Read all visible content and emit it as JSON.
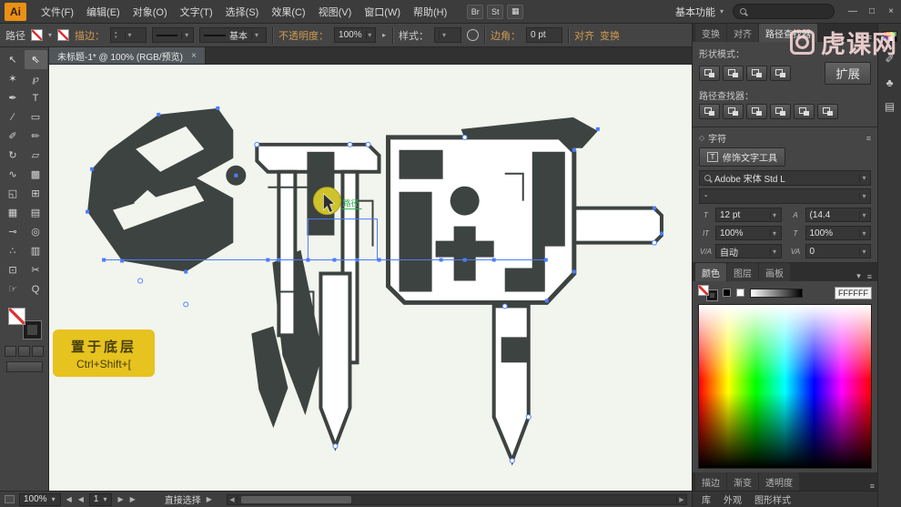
{
  "menubar": {
    "app_label": "Ai",
    "items": [
      "文件(F)",
      "编辑(E)",
      "对象(O)",
      "文字(T)",
      "选择(S)",
      "效果(C)",
      "视图(V)",
      "窗口(W)",
      "帮助(H)"
    ],
    "quick_icons": [
      {
        "name": "bridge-button",
        "glyph": "Br"
      },
      {
        "name": "stock-button",
        "glyph": "St"
      },
      {
        "name": "arrange-documents-button",
        "glyph": "▦"
      }
    ],
    "workspace_label": "基本功能",
    "search_value": "",
    "window_controls": {
      "minimize": "—",
      "restore": "□",
      "close": "×"
    }
  },
  "controlbar": {
    "context_label": "路径",
    "stroke_label": "描边：",
    "stroke_weight_value": "",
    "brush_name": "基本",
    "opacity_label": "不透明度：",
    "opacity_value": "100%",
    "style_label": "样式：",
    "corner_label": "边角：",
    "corner_value": "0 pt",
    "align_label": "对齐",
    "transform_label": "变换"
  },
  "watermark_text": "虎课网",
  "document_tab": {
    "title": "未标题-1* @ 100% (RGB/预览)",
    "close_glyph": "×"
  },
  "toolbar": {
    "tools": [
      {
        "name": "selection-tool",
        "glyph": "↖"
      },
      {
        "name": "direct-selection-tool",
        "glyph": "⇖",
        "active": true
      },
      {
        "name": "magic-wand-tool",
        "glyph": "✶"
      },
      {
        "name": "lasso-tool",
        "glyph": "℘"
      },
      {
        "name": "pen-tool",
        "glyph": "✒"
      },
      {
        "name": "type-tool",
        "glyph": "T"
      },
      {
        "name": "line-segment-tool",
        "glyph": "∕"
      },
      {
        "name": "rectangle-tool",
        "glyph": "▭"
      },
      {
        "name": "paintbrush-tool",
        "glyph": "✐"
      },
      {
        "name": "pencil-tool",
        "glyph": "✏"
      },
      {
        "name": "rotate-tool",
        "glyph": "↻"
      },
      {
        "name": "scale-tool",
        "glyph": "▱"
      },
      {
        "name": "width-tool",
        "glyph": "∿"
      },
      {
        "name": "free-transform-tool",
        "glyph": "▩"
      },
      {
        "name": "shape-builder-tool",
        "glyph": "◱"
      },
      {
        "name": "perspective-grid-tool",
        "glyph": "⊞"
      },
      {
        "name": "mesh-tool",
        "glyph": "▦"
      },
      {
        "name": "gradient-tool",
        "glyph": "▤"
      },
      {
        "name": "eyedropper-tool",
        "glyph": "⊸"
      },
      {
        "name": "blend-tool",
        "glyph": "◎"
      },
      {
        "name": "symbol-sprayer-tool",
        "glyph": "∴"
      },
      {
        "name": "column-graph-tool",
        "glyph": "▥"
      },
      {
        "name": "artboard-tool",
        "glyph": "⊡"
      },
      {
        "name": "slice-tool",
        "glyph": "✂"
      },
      {
        "name": "hand-tool",
        "glyph": "☞"
      },
      {
        "name": "zoom-tool",
        "glyph": "Q"
      }
    ]
  },
  "canvas": {
    "tooltip_line1": "置于底层",
    "tooltip_line2": "Ctrl+Shift+[",
    "path_label": "路径"
  },
  "panels": {
    "dock_tabs": {
      "labels": [
        "变换",
        "对齐",
        "路径查找器"
      ],
      "active": 2
    },
    "pathfinder": {
      "shape_modes_label": "形状模式：",
      "shape_mode_buttons": [
        "unite",
        "minus-front",
        "intersect",
        "exclude"
      ],
      "expand_label": "扩展",
      "pathfinder_label": "路径查找器：",
      "pathfinder_buttons": [
        "divide",
        "trim",
        "merge",
        "crop",
        "outline",
        "minus-back"
      ]
    },
    "character": {
      "header": "字符",
      "touch_tool_icon": "T",
      "touch_tool_label": "修饰文字工具",
      "font_value": "Adobe 宋体 Std L",
      "style_value": "-",
      "fields": [
        {
          "name": "font-size",
          "icon": "T",
          "value": "12 pt"
        },
        {
          "name": "leading",
          "icon": "A",
          "value": "(14.4"
        },
        {
          "name": "vertical-scale",
          "icon": "IT",
          "value": "100%"
        },
        {
          "name": "horizontal-scale",
          "icon": "T",
          "value": "100%"
        },
        {
          "name": "kerning",
          "icon": "V/A",
          "value": "自动"
        },
        {
          "name": "tracking",
          "icon": "VA",
          "value": "0"
        }
      ]
    },
    "color": {
      "tabs": {
        "labels": [
          "颜色",
          "图层",
          "画板"
        ],
        "active": 0
      },
      "hex": "FFFFFF"
    },
    "bottom_tabs": {
      "labels": [
        "描边",
        "渐变",
        "透明度"
      ],
      "active": -1
    },
    "bottom_tabs2": {
      "labels": [
        "库",
        "外观",
        "图形样式"
      ],
      "active": -1
    }
  },
  "right_strip": {
    "swatch_colors": [
      "#c33",
      "#e82",
      "#ed3",
      "#4a4",
      "#36b",
      "#849",
      "#fff",
      "#000"
    ],
    "icons": [
      {
        "name": "swatches-icon"
      },
      {
        "name": "brushes-icon",
        "glyph": "✐"
      },
      {
        "name": "symbols-icon",
        "glyph": "♣"
      },
      {
        "name": "graphic-styles-icon",
        "glyph": "▤"
      }
    ]
  },
  "statusbar": {
    "zoom": "100%",
    "artboard": "1",
    "tool_name": "直接选择"
  }
}
